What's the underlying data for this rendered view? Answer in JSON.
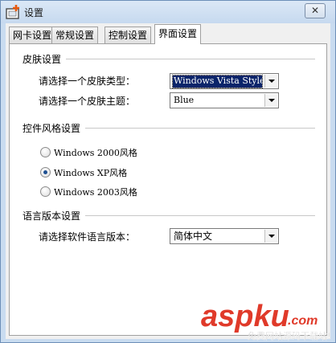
{
  "window": {
    "title": "设置",
    "close_glyph": "✕"
  },
  "tabs": [
    {
      "label": "网卡设置",
      "active": false
    },
    {
      "label": "常规设置",
      "active": false
    },
    {
      "label": "控制设置",
      "active": false
    },
    {
      "label": "界面设置",
      "active": true
    }
  ],
  "skin_group": {
    "title": "皮肤设置",
    "type_label": "请选择一个皮肤类型：",
    "type_value": "Windows Vista Style",
    "theme_label": "请选择一个皮肤主题：",
    "theme_value": "Blue"
  },
  "style_group": {
    "title": "控件风格设置",
    "options": [
      {
        "label": "Windows 2000风格",
        "checked": false
      },
      {
        "label": "Windows XP风格",
        "checked": true
      },
      {
        "label": "Windows 2003风格",
        "checked": false
      }
    ]
  },
  "language_group": {
    "title": "语言版本设置",
    "label": "请选择软件语言版本：",
    "value": "简体中文"
  },
  "watermark": {
    "brand": "aspku",
    "domain": ".com",
    "slogan": "免费网站源码下载站!"
  },
  "colors": {
    "window_frame": "#c9dcf0",
    "selection": "#0a246a",
    "watermark_red": "#e03a2a"
  }
}
